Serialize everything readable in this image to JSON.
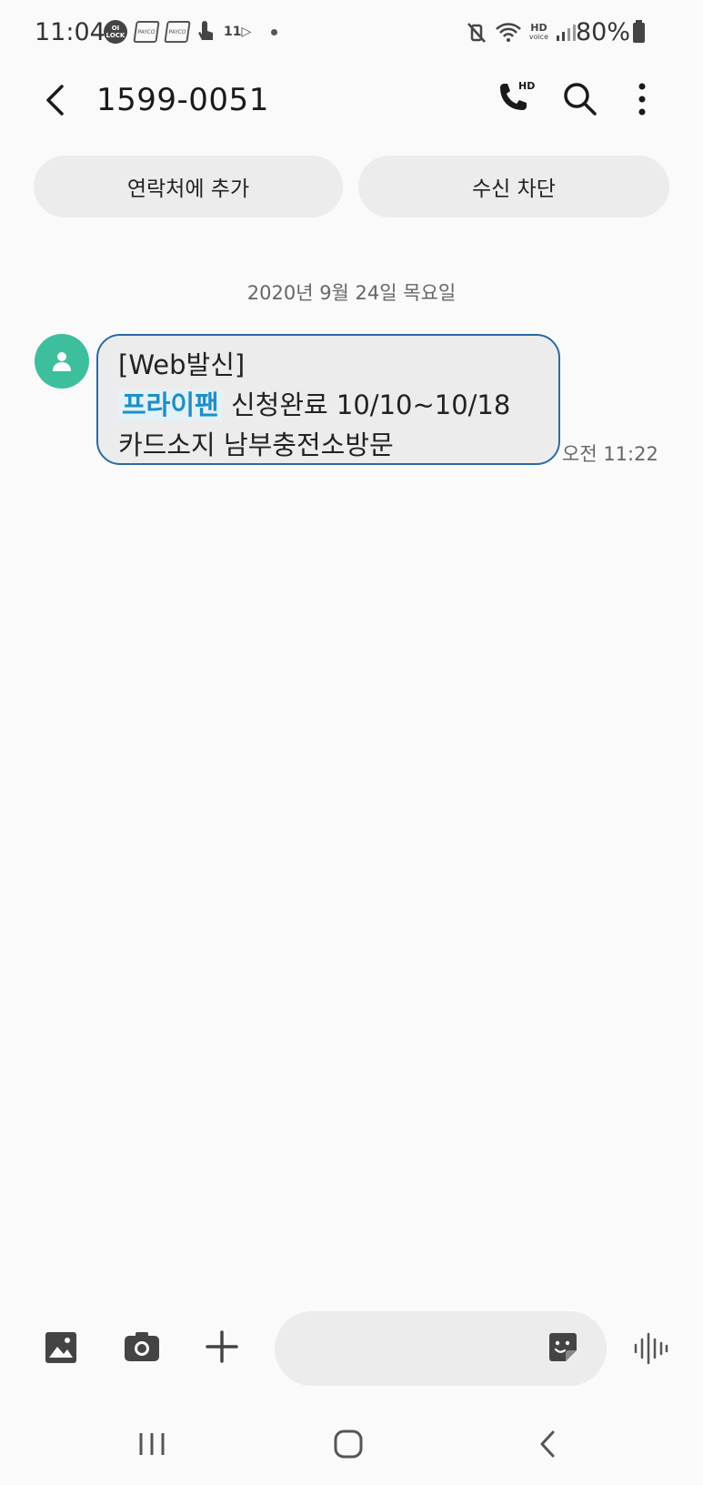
{
  "status_bar": {
    "time": "11:04",
    "left_badges": [
      "OI LOCK",
      "PAYCO",
      "PAYCO"
    ],
    "eleven_label": "11",
    "hd_label": "HD",
    "hd_sub": "voice",
    "battery": "80%"
  },
  "header": {
    "title": "1599-0051",
    "icons": [
      "back-arrow-icon",
      "hd-call-icon",
      "search-icon",
      "more-vert-icon"
    ]
  },
  "actions": {
    "add_contact": "연락처에 추가",
    "block": "수신 차단"
  },
  "conversation": {
    "date": "2020년 9월 24일 목요일",
    "message": {
      "line1": "[Web발신]",
      "highlight": "프라이팬",
      "line2_rest": " 신청완료 10/10~10/18",
      "line3": "카드소지 남부충전소방문",
      "time": "오전 11:22"
    }
  },
  "composer": {
    "placeholder": ""
  },
  "colors": {
    "avatar": "#3dbf9d",
    "bubble_border": "#2a6aa3",
    "highlight": "#1d8fc7"
  }
}
